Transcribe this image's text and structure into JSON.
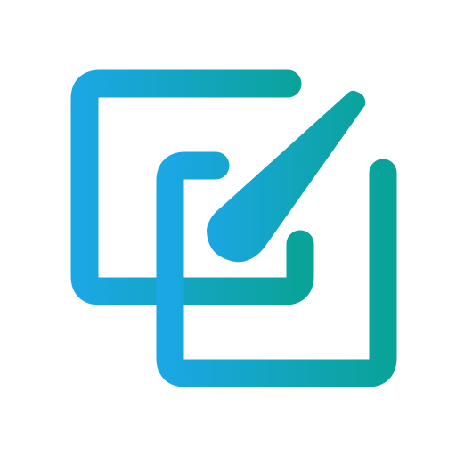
{
  "icon": {
    "name": "edit-duplicate-icon",
    "colors": {
      "gradient_start": "#1aa7e3",
      "gradient_end": "#0aa39a",
      "background": "#ffffff"
    }
  }
}
